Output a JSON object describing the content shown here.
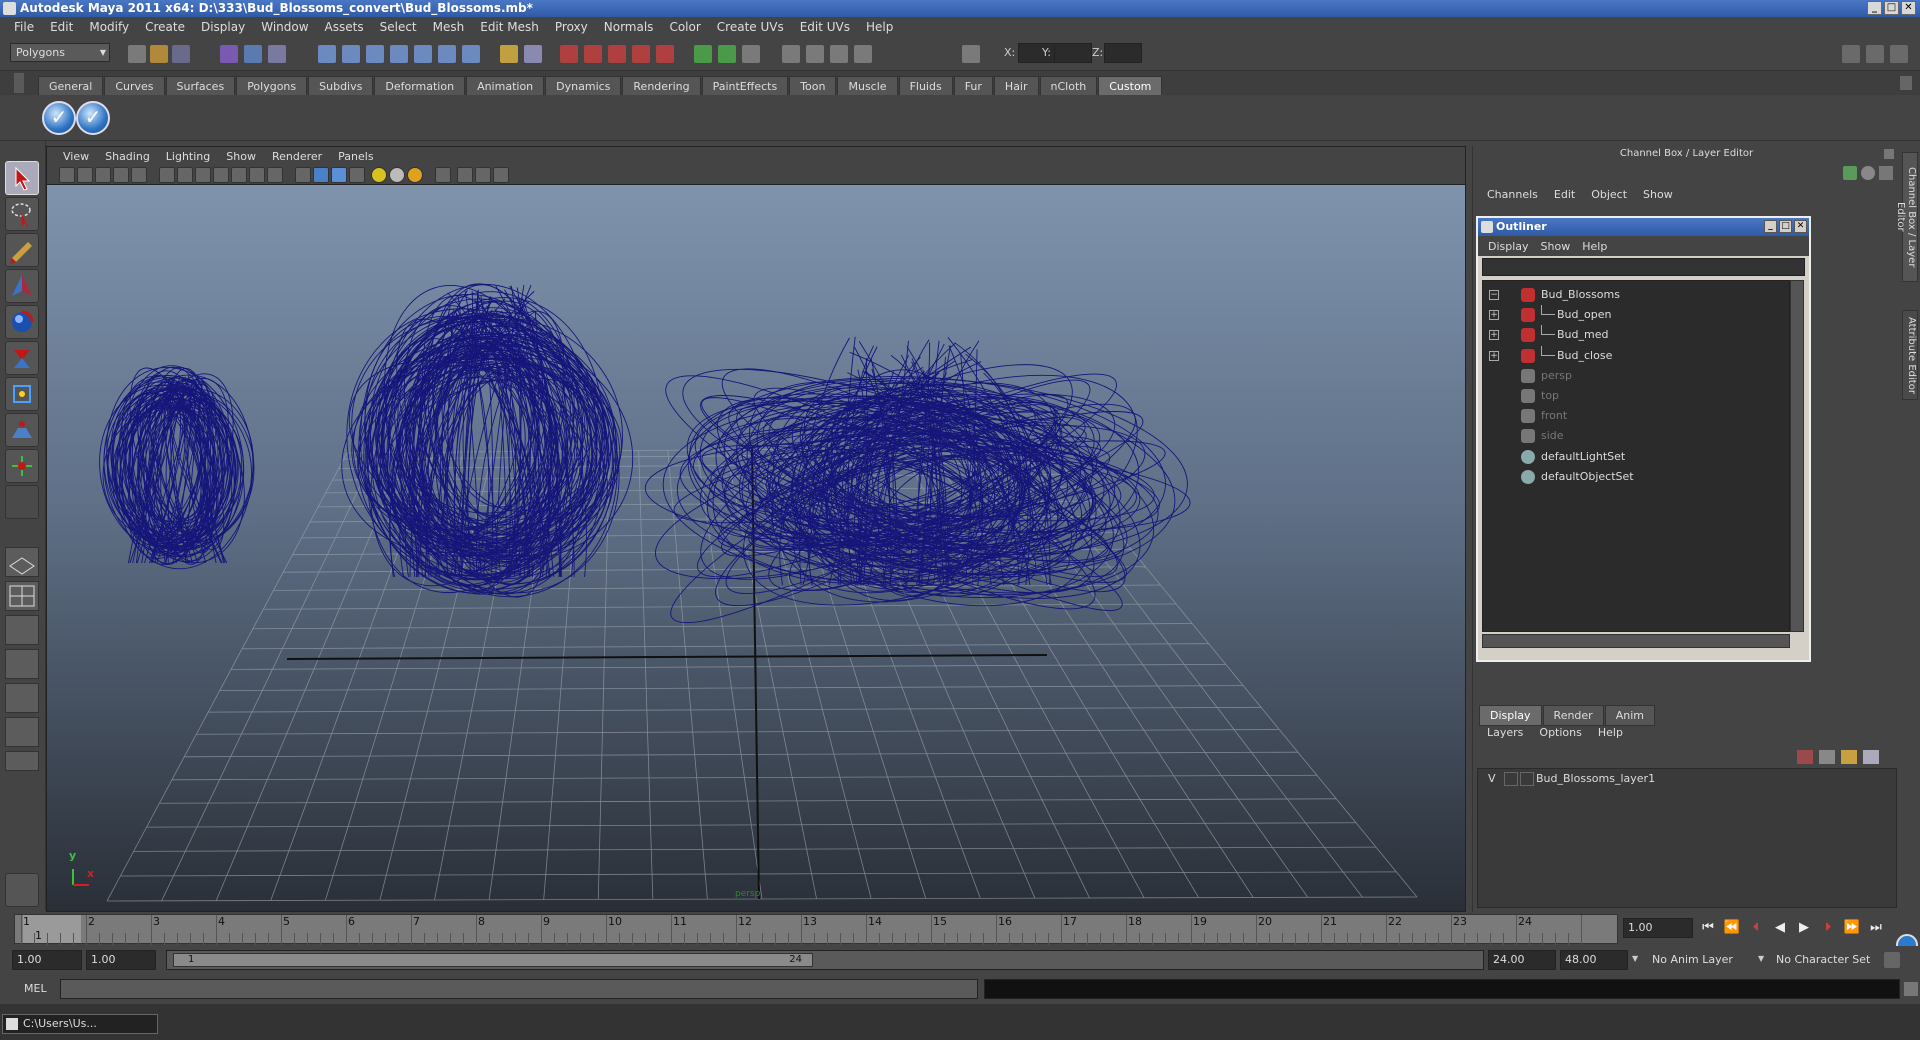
{
  "window": {
    "title": "Autodesk Maya 2011 x64: D:\\333\\Bud_Blossoms_convert\\Bud_Blossoms.mb*",
    "min": "_",
    "max": "□",
    "close": "✕"
  },
  "menubar": [
    "File",
    "Edit",
    "Modify",
    "Create",
    "Display",
    "Window",
    "Assets",
    "Select",
    "Mesh",
    "Edit Mesh",
    "Proxy",
    "Normals",
    "Color",
    "Create UVs",
    "Edit UVs",
    "Help"
  ],
  "statusline": {
    "mode": "Polygons",
    "x_label": "X:",
    "y_label": "Y:",
    "z_label": "Z:"
  },
  "shelf": {
    "tabs": [
      "General",
      "Curves",
      "Surfaces",
      "Polygons",
      "Subdivs",
      "Deformation",
      "Animation",
      "Dynamics",
      "Rendering",
      "PaintEffects",
      "Toon",
      "Muscle",
      "Fluids",
      "Fur",
      "Hair",
      "nCloth",
      "Custom"
    ],
    "active": "Custom",
    "button_glyph": "✓"
  },
  "viewport": {
    "menus": [
      "View",
      "Shading",
      "Lighting",
      "Show",
      "Renderer",
      "Panels"
    ],
    "camera_label": "persp",
    "axis_y": "y",
    "axis_x": "x"
  },
  "channelbox": {
    "title": "Channel Box / Layer Editor",
    "menus": [
      "Channels",
      "Edit",
      "Object",
      "Show"
    ]
  },
  "outliner": {
    "title": "Outliner",
    "menus": [
      "Display",
      "Show",
      "Help"
    ],
    "items": [
      {
        "label": "Bud_Blossoms",
        "expander": "−"
      },
      {
        "label": "Bud_open",
        "expander": "+"
      },
      {
        "label": "Bud_med",
        "expander": "+"
      },
      {
        "label": "Bud_close",
        "expander": "+"
      },
      {
        "label": "persp",
        "expander": ""
      },
      {
        "label": "top",
        "expander": ""
      },
      {
        "label": "front",
        "expander": ""
      },
      {
        "label": "side",
        "expander": ""
      },
      {
        "label": "defaultLightSet",
        "expander": ""
      },
      {
        "label": "defaultObjectSet",
        "expander": ""
      }
    ]
  },
  "layer_editor": {
    "tabs": [
      "Display",
      "Render",
      "Anim"
    ],
    "active": "Display",
    "menus": [
      "Layers",
      "Options",
      "Help"
    ],
    "layer": {
      "visible": "V",
      "name": "Bud_Blossoms_layer1"
    }
  },
  "side_tabs": {
    "channel": "Channel Box / Layer Editor",
    "attr": "Attribute Editor"
  },
  "timeline": {
    "ticks": [
      "1",
      "2",
      "3",
      "4",
      "5",
      "6",
      "7",
      "8",
      "9",
      "10",
      "11",
      "12",
      "13",
      "14",
      "15",
      "16",
      "17",
      "18",
      "19",
      "20",
      "21",
      "22",
      "23",
      "24"
    ],
    "current_frame": "1.00",
    "first_frame_label": "1"
  },
  "range": {
    "start": "1.00",
    "playback_start": "1.00",
    "slider_min": "1",
    "slider_max": "24",
    "playback_end": "24.00",
    "end": "48.00",
    "anim_layer": "No Anim Layer",
    "char_set": "No Character Set"
  },
  "command": {
    "label": "MEL"
  },
  "taskbar": {
    "item": "C:\\Users\\Us..."
  },
  "colors": {
    "wireframe": "#1a1a7a",
    "title_blue": "#2f5aa6",
    "viewport_top": "#7f93ad",
    "viewport_bottom": "#2a2f37"
  },
  "icons": {
    "select_tool": "arrow-icon",
    "lasso_tool": "lasso-icon",
    "paint_tool": "brush-icon",
    "move_tool": "move-icon",
    "rotate_tool": "rotate-icon",
    "scale_tool": "scale-icon"
  }
}
